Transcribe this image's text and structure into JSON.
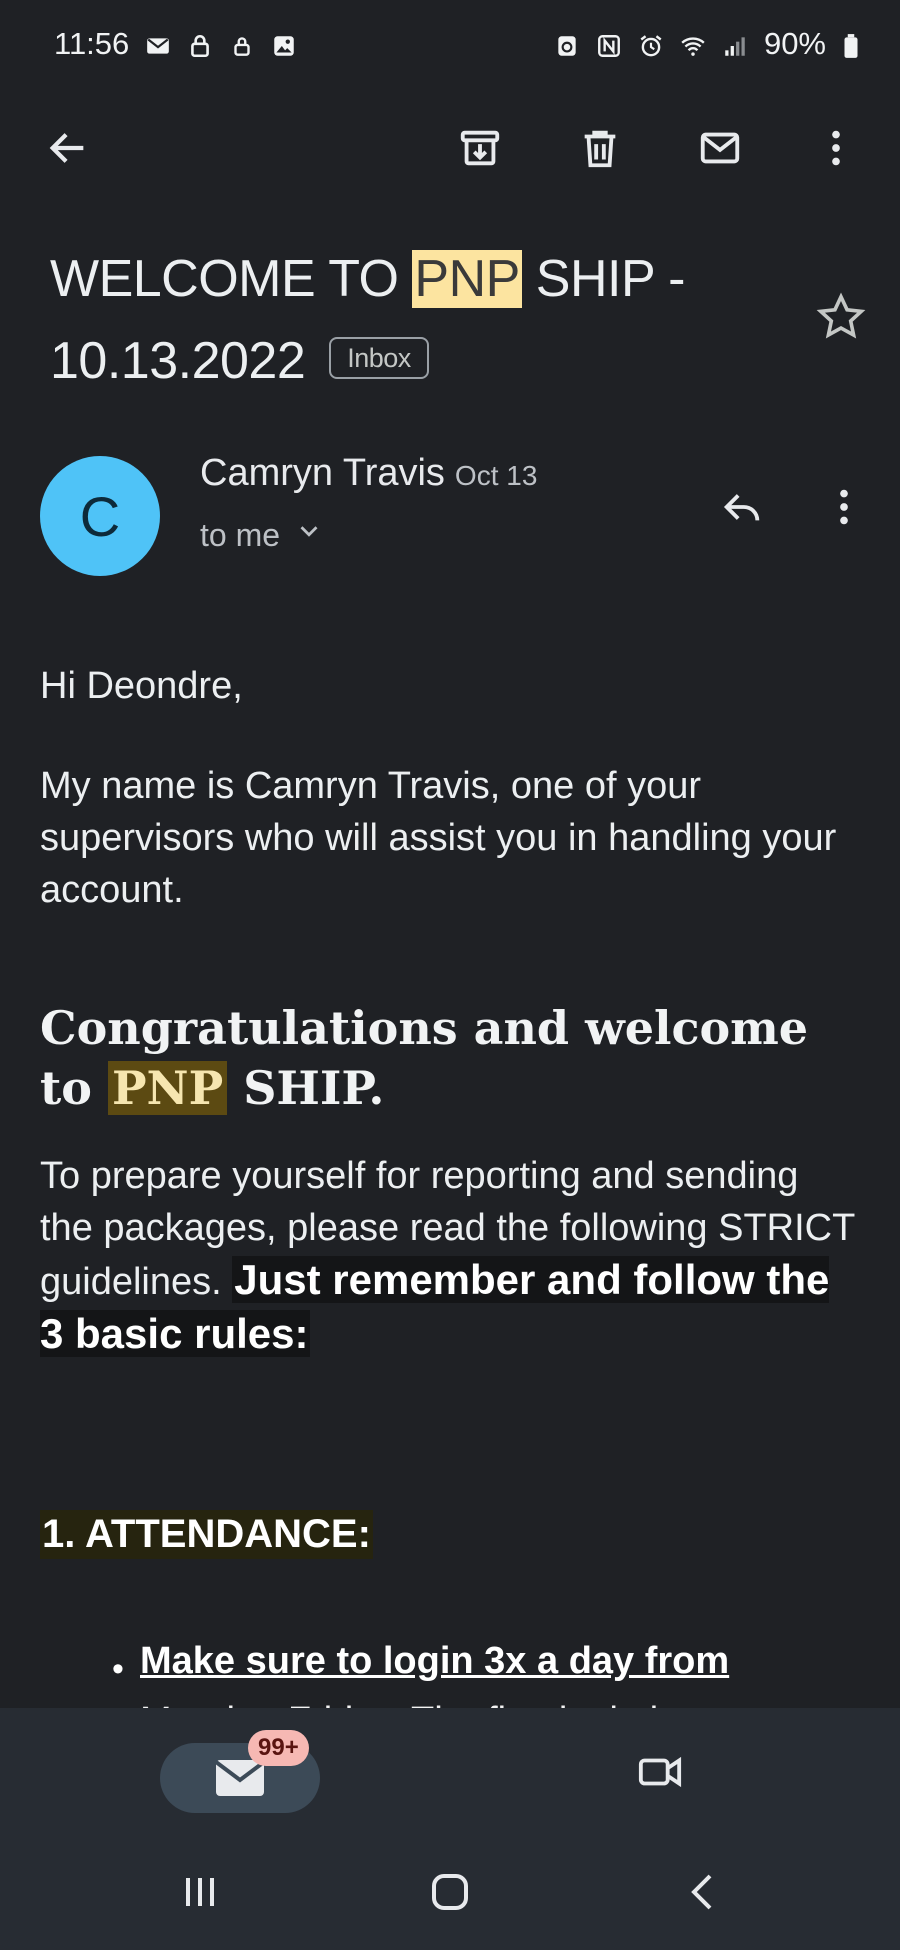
{
  "status_bar": {
    "time": "11:56",
    "battery": "90%",
    "left_icons": [
      "mail-icon",
      "lock-icon",
      "lock-small-icon",
      "image-icon"
    ],
    "right_icons": [
      "recycle-icon",
      "nfc-icon",
      "alarm-icon",
      "wifi-icon",
      "signal-icon",
      "battery-icon"
    ]
  },
  "toolbar": {
    "back": "back-arrow-icon",
    "actions": [
      "archive-icon",
      "delete-icon",
      "mark-unread-icon",
      "more-vert-icon"
    ]
  },
  "email": {
    "subject_part1": "WELCOME TO ",
    "subject_highlight": "PNP",
    "subject_part2": " SHIP -",
    "subject_line2": "10.13.2022",
    "label_chip": "Inbox",
    "sender": {
      "initial": "C",
      "name": "Camryn Travis",
      "date": "Oct 13",
      "to": "to me",
      "avatar_color": "#4fc3f7"
    },
    "body": {
      "greeting": "Hi  Deondre,",
      "intro": "My name is Camryn Travis, one of your supervisors who will assist you in handling your account.",
      "congrats_part1": "Congratulations and welcome to  ",
      "congrats_highlight": "PNP",
      "congrats_part2": " SHIP.",
      "prepare_text": "To prepare yourself for reporting and sending the packages, please read the following STRICT guidelines. ",
      "prepare_bold": "Just remember and follow the 3 basic rules:",
      "section_heading": "1. ATTENDANCE:",
      "bullet_bold": "Make sure to login 3x a day from",
      "bullet_cut": "Monday-Friday. The first login has to"
    }
  },
  "bottom_nav": {
    "mail_badge": "99+",
    "items": [
      "mail-icon",
      "video-icon"
    ]
  },
  "system_nav": [
    "recent-apps-icon",
    "home-icon",
    "back-icon"
  ],
  "colors": {
    "background": "#1f2125",
    "subject_highlight": "#fce4a0",
    "body_highlight": "#5c4a12",
    "badge": "#f6b8b3"
  }
}
